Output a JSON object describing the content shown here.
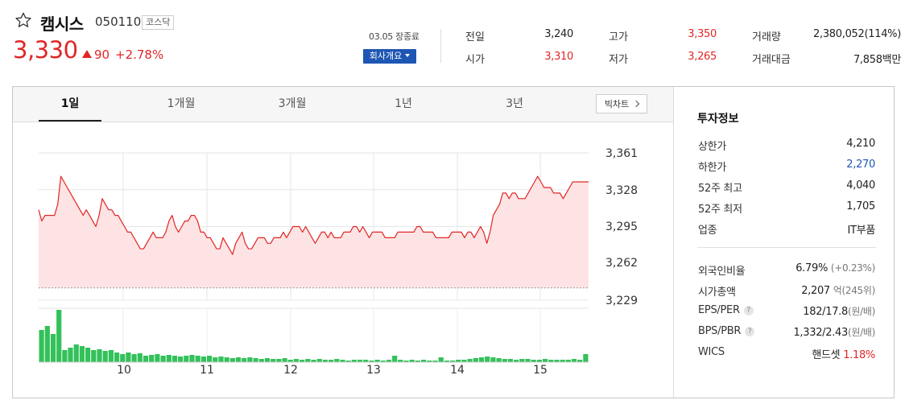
{
  "stock": {
    "name": "캠시스",
    "code": "050110",
    "market": "코스닥",
    "price": "3,330",
    "change": "90",
    "change_pct": "+2.78%",
    "close_time": "03.05 장종료",
    "company_info_label": "회사개요"
  },
  "quotes": [
    {
      "label": "전일",
      "value": "3,240",
      "color": "#222222"
    },
    {
      "label": "고가",
      "value": "3,350",
      "color": "#e12626"
    },
    {
      "label": "거래량",
      "value": "2,380,052(114%)",
      "color": "#222222"
    },
    {
      "label": "시가",
      "value": "3,310",
      "color": "#e12626"
    },
    {
      "label": "저가",
      "value": "3,265",
      "color": "#e12626"
    },
    {
      "label": "거래대금",
      "value": "7,858백만",
      "color": "#222222"
    }
  ],
  "tabs": [
    "1일",
    "1개월",
    "3개월",
    "1년",
    "3년"
  ],
  "active_tab": "1일",
  "big_chart_label": "빅차트",
  "chart_data": [
    {
      "type": "area",
      "y_ticks": [
        "3,361",
        "3,328",
        "3,295",
        "3,262",
        "3,229"
      ],
      "ylim": [
        3229,
        3361
      ],
      "x_ticks": [
        "10",
        "11",
        "12",
        "13",
        "14",
        "15"
      ],
      "baseline": 3240,
      "color": "#e12626",
      "fill": "#fde3e3",
      "values": [
        3310,
        3300,
        3305,
        3305,
        3305,
        3305,
        3315,
        3340,
        3335,
        3330,
        3325,
        3320,
        3315,
        3310,
        3305,
        3310,
        3305,
        3300,
        3295,
        3305,
        3320,
        3315,
        3310,
        3310,
        3305,
        3305,
        3300,
        3295,
        3290,
        3290,
        3285,
        3280,
        3275,
        3275,
        3280,
        3285,
        3290,
        3285,
        3285,
        3285,
        3290,
        3300,
        3305,
        3295,
        3290,
        3295,
        3300,
        3300,
        3305,
        3305,
        3300,
        3290,
        3290,
        3285,
        3285,
        3280,
        3275,
        3275,
        3285,
        3280,
        3275,
        3270,
        3280,
        3285,
        3290,
        3280,
        3275,
        3275,
        3280,
        3285,
        3285,
        3285,
        3280,
        3280,
        3285,
        3285,
        3285,
        3290,
        3285,
        3290,
        3295,
        3295,
        3295,
        3290,
        3295,
        3290,
        3285,
        3280,
        3285,
        3290,
        3290,
        3285,
        3290,
        3285,
        3285,
        3285,
        3290,
        3290,
        3290,
        3295,
        3295,
        3290,
        3295,
        3290,
        3285,
        3290,
        3290,
        3290,
        3290,
        3285,
        3285,
        3285,
        3285,
        3290,
        3290,
        3290,
        3290,
        3290,
        3290,
        3295,
        3295,
        3290,
        3290,
        3290,
        3290,
        3285,
        3285,
        3285,
        3285,
        3285,
        3290,
        3290,
        3290,
        3290,
        3285,
        3290,
        3290,
        3285,
        3290,
        3295,
        3290,
        3280,
        3290,
        3305,
        3310,
        3315,
        3325,
        3325,
        3320,
        3325,
        3325,
        3320,
        3320,
        3320,
        3325,
        3330,
        3335,
        3340,
        3335,
        3330,
        3330,
        3330,
        3325,
        3325,
        3325,
        3320,
        3325,
        3330,
        3335,
        3335,
        3335,
        3335,
        3335,
        3335
      ]
    },
    {
      "type": "bar",
      "x_ticks": [
        "10",
        "11",
        "12",
        "13",
        "14",
        "15"
      ],
      "color": "#33c15a",
      "values": [
        40,
        45,
        35,
        65,
        15,
        18,
        22,
        20,
        18,
        15,
        16,
        14,
        15,
        12,
        10,
        12,
        10,
        11,
        8,
        9,
        10,
        8,
        9,
        8,
        7,
        8,
        9,
        8,
        7,
        8,
        6,
        7,
        6,
        5,
        6,
        5,
        6,
        5,
        4,
        5,
        4,
        4,
        5,
        3,
        4,
        3,
        4,
        3,
        4,
        3,
        3,
        4,
        3,
        2,
        3,
        3,
        3,
        2,
        3,
        2,
        3,
        8,
        3,
        2,
        3,
        2,
        3,
        2,
        2,
        6,
        2,
        2,
        3,
        3,
        4,
        5,
        6,
        7,
        6,
        5,
        4,
        4,
        3,
        4,
        4,
        3,
        3,
        4,
        3,
        3,
        3,
        3,
        4,
        3,
        10
      ]
    }
  ],
  "info": {
    "title": "투자정보",
    "rows_a": [
      {
        "label": "상한가",
        "value": "4,210",
        "color": "#e12626"
      },
      {
        "label": "하한가",
        "value": "2,270",
        "color": "#1e56b3"
      },
      {
        "label": "52주 최고",
        "value": "4,040",
        "color": "#222222"
      },
      {
        "label": "52주 최저",
        "value": "1,705",
        "color": "#222222"
      },
      {
        "label": "업종",
        "value": "IT부품",
        "color": "#222222"
      }
    ],
    "foreign_label": "외국인비율",
    "foreign_value": "6.79%",
    "foreign_sub": "(+0.23%)",
    "mcap_label": "시가총액",
    "mcap_value": "2,207",
    "mcap_sub": "억(245위)",
    "eps_label": "EPS/PER",
    "eps_value": "182/17.8",
    "eps_sub": "(원/배)",
    "bps_label": "BPS/PBR",
    "bps_value": "1,332/2.43",
    "bps_sub": "(원/배)",
    "wics_label": "WICS",
    "wics_value": "핸드셋",
    "wics_pct": "1.18%",
    "help_mark": "?"
  }
}
